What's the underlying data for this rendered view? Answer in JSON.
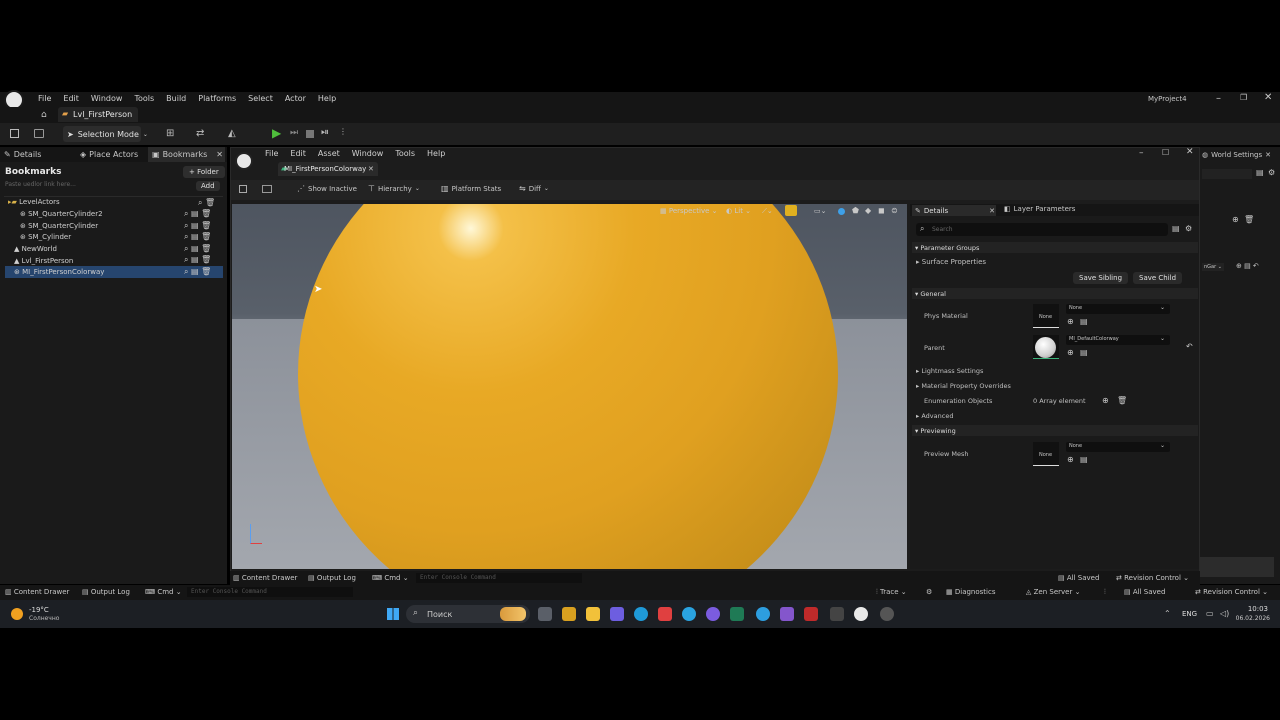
{
  "app": {
    "project": "MyProject4",
    "level_tab": "Lvl_FirstPerson"
  },
  "menu": {
    "items": [
      "File",
      "Edit",
      "Window",
      "Tools",
      "Build",
      "Platforms",
      "Select",
      "Actor",
      "Help"
    ]
  },
  "toolbar": {
    "selection_mode": "Selection Mode"
  },
  "left_panel": {
    "tabs": [
      "Details",
      "Place Actors",
      "Bookmarks"
    ],
    "title": "Bookmarks",
    "folder_btn": "+ Folder",
    "paste_hint": "Paste uedlor link here...",
    "add_btn": "Add",
    "tree": [
      "LevelActors",
      "SM_QuarterCylinder2",
      "SM_QuarterCylinder",
      "SM_Cylinder",
      "NewWorld",
      "Lvl_FirstPerson",
      "MI_FirstPersonColorway"
    ]
  },
  "editor": {
    "menu": [
      "File",
      "Edit",
      "Asset",
      "Window",
      "Tools",
      "Help"
    ],
    "tab": "MI_FirstPersonColorway",
    "toolbar": [
      "Show Inactive",
      "Hierarchy",
      "Platform Stats",
      "Diff"
    ],
    "viewport": {
      "perspective": "Perspective",
      "lit": "Lit"
    }
  },
  "details": {
    "tabs": [
      "Details",
      "Layer Parameters"
    ],
    "search_placeholder": "Search",
    "parameter_groups": "Parameter Groups",
    "surface_properties": "Surface Properties",
    "save_sibling": "Save Sibling",
    "save_child": "Save Child",
    "general": "General",
    "phys_material": "Phys Material",
    "none": "None",
    "parent": "Parent",
    "parent_value": "MI_DefaultColorway",
    "lightmass": "Lightmass Settings",
    "material_overrides": "Material Property Overrides",
    "enum_objects": "Enumeration Objects",
    "enum_value": "0 Array element",
    "advanced": "Advanced",
    "previewing": "Previewing",
    "preview_mesh": "Preview Mesh"
  },
  "right_panel": {
    "world_settings": "World Settings",
    "nav_text": "nGar"
  },
  "editor_bottom": {
    "content_drawer": "Content Drawer",
    "output_log": "Output Log",
    "cmd": "Cmd",
    "console_placeholder": "Enter Console Command"
  },
  "main_bottom": {
    "content_drawer": "Content Drawer",
    "output_log": "Output Log",
    "cmd": "Cmd",
    "console_placeholder": "Enter Console Command",
    "trace": "Trace",
    "diagnostics": "Diagnostics",
    "zen_server": "Zen Server",
    "all_saved": "All Saved",
    "revision_control": "Revision Control"
  },
  "editor_status": {
    "all_saved": "All Saved",
    "revision_control": "Revision Control"
  },
  "taskbar": {
    "weather_temp": "-19°C",
    "weather_desc": "Солнечно",
    "search": "Поиск",
    "lang": "ENG",
    "time": "10:03",
    "date": "06.02.2026"
  }
}
